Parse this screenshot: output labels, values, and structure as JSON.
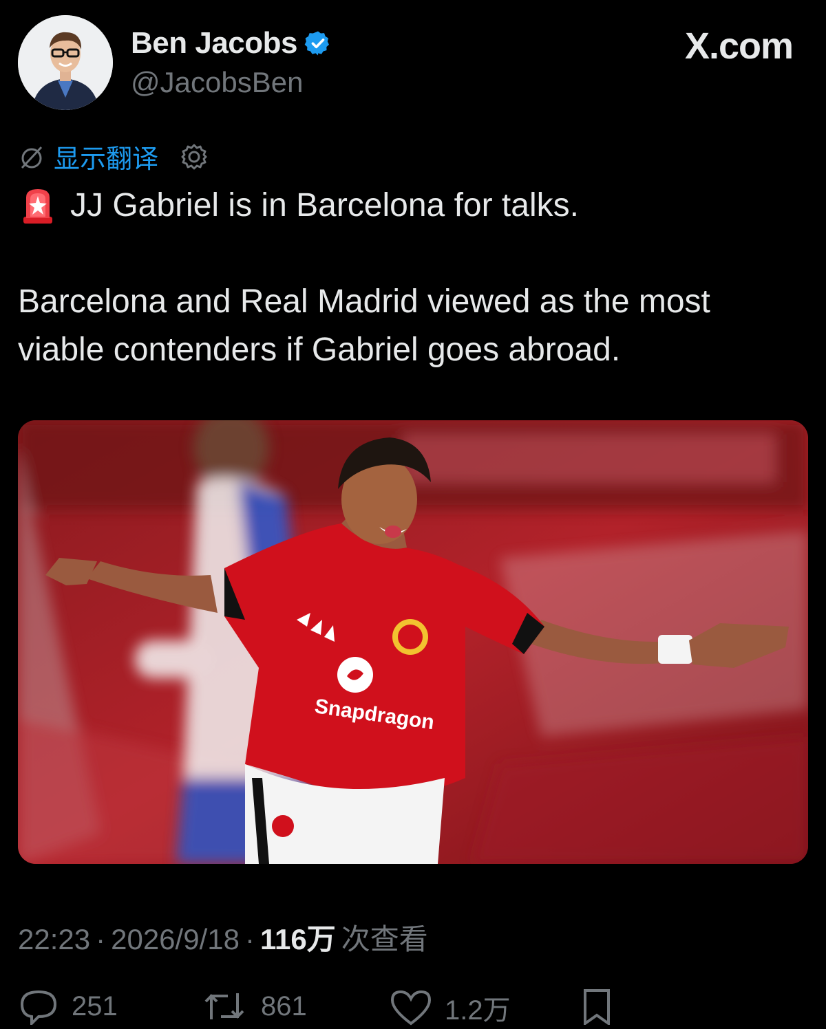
{
  "author": {
    "name": "Ben Jacobs",
    "handle": "@JacobsBen",
    "verified": true,
    "verified_color": "#1d9bf0"
  },
  "brand": "X.com",
  "translate": {
    "label": "显示翻译",
    "icon": "globe-off-icon",
    "settings_icon": "gear-icon"
  },
  "tweet": {
    "emoji": "rotating-light-icon",
    "line1": "JJ Gabriel is in Barcelona for talks.",
    "line2": "Barcelona and Real Madrid viewed as the most",
    "line3": "viable contenders if Gabriel goes abroad."
  },
  "media": {
    "alt_icon": "football-photo",
    "shirt_sponsor": "Snapdragon"
  },
  "meta": {
    "time": "22:23",
    "date": "2026/9/18",
    "views_count": "116万",
    "views_label": "次查看",
    "sep": "·"
  },
  "actions": {
    "replies": "251",
    "reposts": "861",
    "likes": "1.2万",
    "reply_icon": "reply-icon",
    "repost_icon": "repost-icon",
    "like_icon": "heart-icon",
    "bookmark_icon": "bookmark-icon"
  },
  "colors": {
    "background": "#000000",
    "text": "#e7e9ea",
    "muted": "#71767b",
    "link": "#1d9bf0",
    "jersey_red": "#d0101c"
  }
}
